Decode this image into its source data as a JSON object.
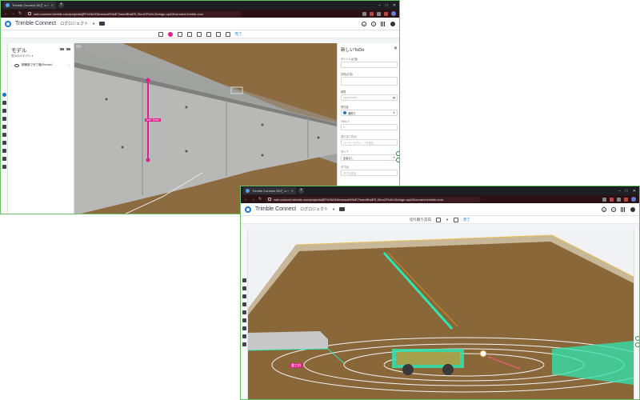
{
  "windows": [
    {
      "tab": {
        "title": "Trimble Connect 3Dビューア・Bo..."
      },
      "url": "web.connect.trimble.com/projects/jEFeOkHGImexwa%3eE7tmeeBhsBTi-ZbmGFb4h-Bv/sign-up&3/connect.trimble.com",
      "app": {
        "brand": "Trimble Connect",
        "project": "ログロジェクト"
      },
      "toolbar": {
        "action": "完了"
      },
      "model_panel": {
        "title": "モデル",
        "subtitle": "表示中のモデル ▾",
        "model_name": "鋼構造で完了機(Rmodel..."
      },
      "viewport": {
        "badge": "既定1",
        "measure": "9m+ 0mm"
      },
      "todo": {
        "title": "新しいToDo",
        "fields": [
          {
            "label": "タイトル(必須)",
            "value": ""
          },
          {
            "label": "説明(必須)",
            "value": ""
          },
          {
            "label": "期限",
            "value": "yyyy/mm/dd"
          },
          {
            "label": "優先度",
            "value": "通常た"
          },
          {
            "label": "ToDo 7",
            "value": "5"
          },
          {
            "label": "割り当て先(0)",
            "value": "ユーザーかグループを追加"
          },
          {
            "label": "タイプ",
            "value": "定義なし"
          },
          {
            "label": "タグ(0)",
            "value": "タグを追加"
          }
        ]
      }
    },
    {
      "tab": {
        "title": "Trimble Connect 3Dビューア・Bo..."
      },
      "url": "web.connect.trimble.com/projects/jEFeOkHGImexwa%3eE7tmeeBhsBTi-ZbmGFb4h-Bv/sign-up&3/connect.trimble.com",
      "app": {
        "brand": "Trimble Connect",
        "project": "ログロジェクト"
      },
      "toolbar": {
        "label": "切り取り方向",
        "action": "完了"
      },
      "viewport": {
        "annotation": "重工机"
      }
    }
  ],
  "colors": {
    "accent": "#1a73c7",
    "measure": "#e0208a",
    "selection": "#2ee6b0",
    "window_border": "#6abf69"
  }
}
